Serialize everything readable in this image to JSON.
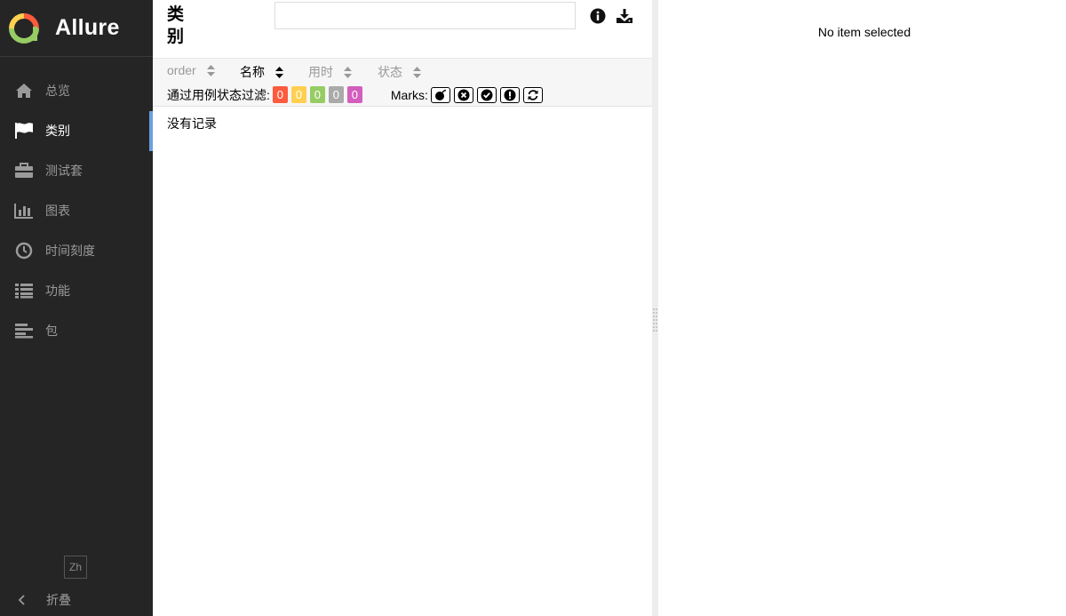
{
  "app": {
    "name": "Allure"
  },
  "sidebar": {
    "items": [
      {
        "label": "总览",
        "icon": "home-icon"
      },
      {
        "label": "类别",
        "icon": "flag-icon",
        "active": true
      },
      {
        "label": "测试套",
        "icon": "briefcase-icon"
      },
      {
        "label": "图表",
        "icon": "bar-chart-icon"
      },
      {
        "label": "时间刻度",
        "icon": "clock-icon"
      },
      {
        "label": "功能",
        "icon": "list-icon"
      },
      {
        "label": "包",
        "icon": "align-left-icon"
      }
    ],
    "language": "Zh",
    "collapse_label": "折叠"
  },
  "pane": {
    "title": "类别",
    "search": {
      "value": "",
      "placeholder": ""
    },
    "sort_columns": [
      "order",
      "名称",
      "用时",
      "状态"
    ],
    "active_sort": "名称",
    "filter_label": "通过用例状态过滤:",
    "status_counts": [
      {
        "status": "failed",
        "count": "0",
        "color": "#fd5a3e"
      },
      {
        "status": "broken",
        "count": "0",
        "color": "#ffd050"
      },
      {
        "status": "passed",
        "count": "0",
        "color": "#97cc64"
      },
      {
        "status": "skipped",
        "count": "0",
        "color": "#aaaaaa"
      },
      {
        "status": "unknown",
        "count": "0",
        "color": "#d35ebe"
      }
    ],
    "marks_label": "Marks:",
    "marks": [
      "flaky-icon",
      "new-failed-icon",
      "new-passed-icon",
      "new-broken-icon",
      "retries-icon"
    ],
    "empty_text": "没有记录"
  },
  "details": {
    "empty_text": "No item selected"
  },
  "colors": {
    "sidebar_bg": "#252525",
    "active_indicator": "#6b9fe0"
  }
}
